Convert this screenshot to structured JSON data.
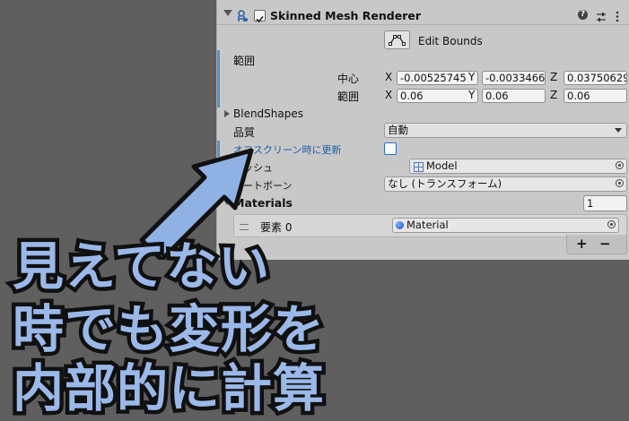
{
  "component": {
    "title": "Skinned Mesh Renderer",
    "enabled": true
  },
  "edit_bounds": {
    "label": "Edit Bounds"
  },
  "bounds": {
    "label": "範囲",
    "center": {
      "label": "中心",
      "x": "-0.00525745",
      "y": "-0.0033466",
      "z": "0.03750629"
    },
    "extent": {
      "label": "範囲",
      "x": "0.06",
      "y": "0.06",
      "z": "0.06"
    },
    "axis_x": "X",
    "axis_y": "Y",
    "axis_z": "Z"
  },
  "blend_shapes": {
    "label": "BlendShapes"
  },
  "quality": {
    "label": "品質",
    "value": "自動"
  },
  "offscreen": {
    "label": "オフスクリーン時に更新",
    "checked": false
  },
  "mesh": {
    "label": "メッシュ",
    "value": "Model"
  },
  "root_bone": {
    "label": "ルートボーン",
    "value": "なし (トランスフォーム)"
  },
  "materials": {
    "label": "Materials",
    "count": "1",
    "elements": [
      {
        "label": "要素 0",
        "value": "Material"
      }
    ],
    "add_label": "+",
    "remove_label": "−"
  },
  "header_icons": [
    "help-icon",
    "preset-icon",
    "more-icon"
  ],
  "overlay": {
    "lines": [
      "見えてない",
      "時でも変形を",
      "内部的に計算"
    ]
  },
  "colors": {
    "inspector_bg": "#c8c8c8",
    "background": "#5f5f5f",
    "accent_blue": "#5294c9",
    "overlay_fill": "#9ab8e8",
    "highlight_label": "#1f5ea8"
  }
}
